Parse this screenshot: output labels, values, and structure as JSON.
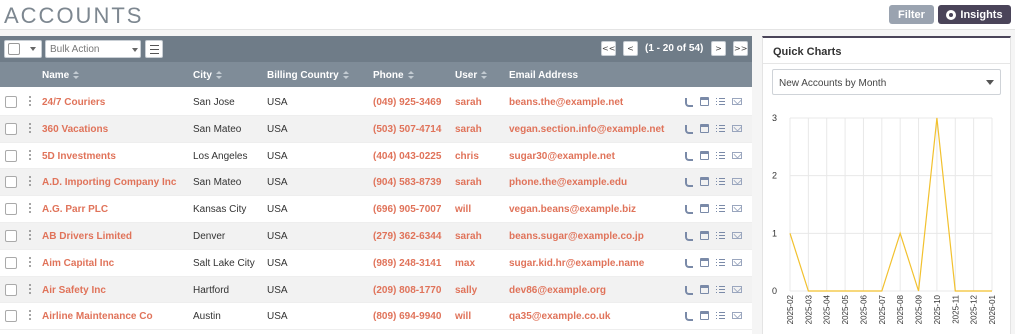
{
  "header": {
    "title": "ACCOUNTS",
    "filter_label": "Filter",
    "insights_label": "Insights"
  },
  "toolbar": {
    "bulk_action": "Bulk Action",
    "first": "<<",
    "prev": "<",
    "next": ">",
    "last": ">>",
    "pagination": "(1 - 20 of 54)"
  },
  "table": {
    "headers": {
      "name": "Name",
      "city": "City",
      "country": "Billing Country",
      "phone": "Phone",
      "user": "User",
      "email": "Email Address"
    },
    "rows": [
      {
        "name": "24/7 Couriers",
        "city": "San Jose",
        "country": "USA",
        "phone": "(049) 925-3469",
        "user": "sarah",
        "email": "beans.the@example.net"
      },
      {
        "name": "360 Vacations",
        "city": "San Mateo",
        "country": "USA",
        "phone": "(503) 507-4714",
        "user": "sarah",
        "email": "vegan.section.info@example.net"
      },
      {
        "name": "5D Investments",
        "city": "Los Angeles",
        "country": "USA",
        "phone": "(404) 043-0225",
        "user": "chris",
        "email": "sugar30@example.net"
      },
      {
        "name": "A.D. Importing Company Inc",
        "city": "San Mateo",
        "country": "USA",
        "phone": "(904) 583-8739",
        "user": "sarah",
        "email": "phone.the@example.edu"
      },
      {
        "name": "A.G. Parr PLC",
        "city": "Kansas City",
        "country": "USA",
        "phone": "(696) 905-7007",
        "user": "will",
        "email": "vegan.beans@example.biz"
      },
      {
        "name": "AB Drivers Limited",
        "city": "Denver",
        "country": "USA",
        "phone": "(279) 362-6344",
        "user": "sarah",
        "email": "beans.sugar@example.co.jp"
      },
      {
        "name": "Aim Capital Inc",
        "city": "Salt Lake City",
        "country": "USA",
        "phone": "(989) 248-3141",
        "user": "max",
        "email": "sugar.kid.hr@example.name"
      },
      {
        "name": "Air Safety Inc",
        "city": "Hartford",
        "country": "USA",
        "phone": "(209) 808-1770",
        "user": "sally",
        "email": "dev86@example.org"
      },
      {
        "name": "Airline Maintenance Co",
        "city": "Austin",
        "country": "USA",
        "phone": "(809) 694-9940",
        "user": "will",
        "email": "qa35@example.co.uk"
      }
    ],
    "row_actions": [
      "phone-icon",
      "calendar-icon",
      "task-list-icon",
      "email-icon"
    ]
  },
  "quick_charts": {
    "title": "Quick Charts",
    "selected_chart": "New Accounts by Month"
  },
  "colors": {
    "link": "#e0735a",
    "toolbar": "#6f7c88",
    "header_row": "#7f8c98",
    "insights": "#4a4459",
    "filter": "#9aa3b0",
    "line": "#f2c12e"
  },
  "chart_data": {
    "type": "line",
    "x": [
      "2025-02",
      "2025-03",
      "2025-04",
      "2025-05",
      "2025-06",
      "2025-07",
      "2025-08",
      "2025-09",
      "2025-10",
      "2025-11",
      "2025-12",
      "2026-01"
    ],
    "series": [
      {
        "values": [
          1,
          0,
          0,
          0,
          0,
          0,
          1,
          0,
          3,
          0,
          0,
          0
        ]
      }
    ],
    "y_ticks": [
      "0",
      "1",
      "2",
      "3"
    ],
    "ylim": [
      0,
      3
    ],
    "grid": true
  }
}
